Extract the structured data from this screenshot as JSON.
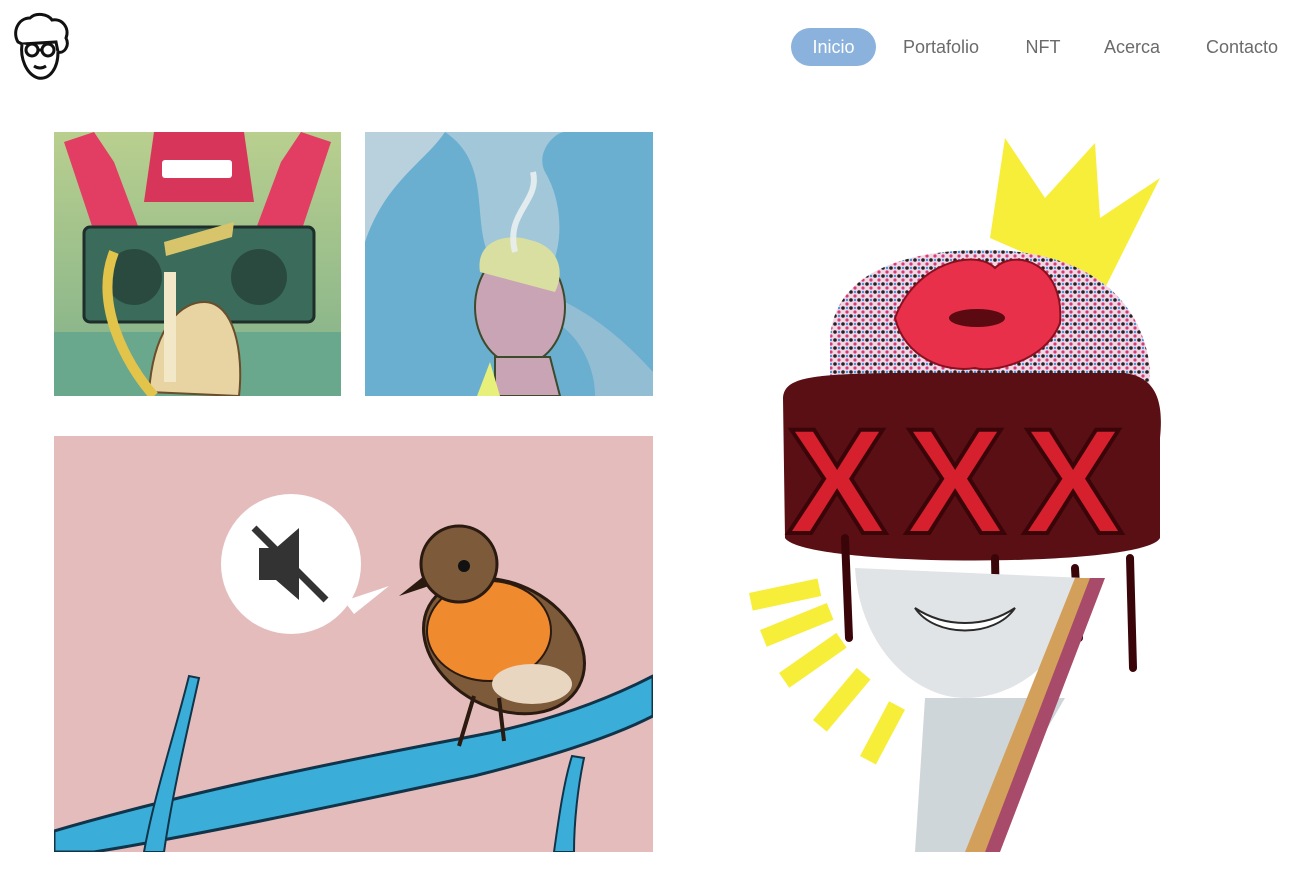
{
  "logo": {
    "icon": "character-face-logo-icon"
  },
  "nav": {
    "items": [
      {
        "label": "Inicio",
        "active": true
      },
      {
        "label": "Portafolio",
        "active": false
      },
      {
        "label": "NFT",
        "active": false
      },
      {
        "label": "Acerca",
        "active": false
      },
      {
        "label": "Contacto",
        "active": false
      }
    ]
  },
  "gallery": {
    "artworks": [
      {
        "name": "hands-boombox-illustration"
      },
      {
        "name": "smoking-bust-illustration"
      },
      {
        "name": "robin-mute-speech-illustration",
        "speech_icon": "mute-speaker-icon"
      },
      {
        "name": "crowned-lips-xxx-collage"
      }
    ]
  },
  "colors": {
    "accent": "#8ab2dd",
    "nav_text": "#6b6b6b",
    "background": "#ffffff"
  }
}
